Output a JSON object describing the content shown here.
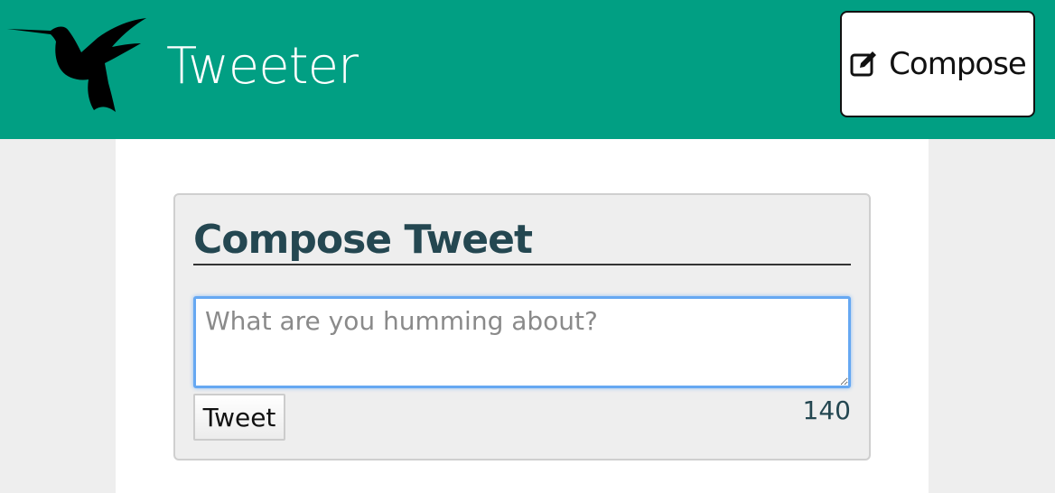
{
  "header": {
    "brand": "Tweeter",
    "logo_icon": "hummingbird-icon",
    "compose_label": "Compose",
    "compose_icon": "edit-icon",
    "background_color": "#019f83"
  },
  "compose": {
    "title": "Compose Tweet",
    "placeholder": "What are you humming about?",
    "value": "",
    "submit_label": "Tweet",
    "char_counter": "140"
  }
}
